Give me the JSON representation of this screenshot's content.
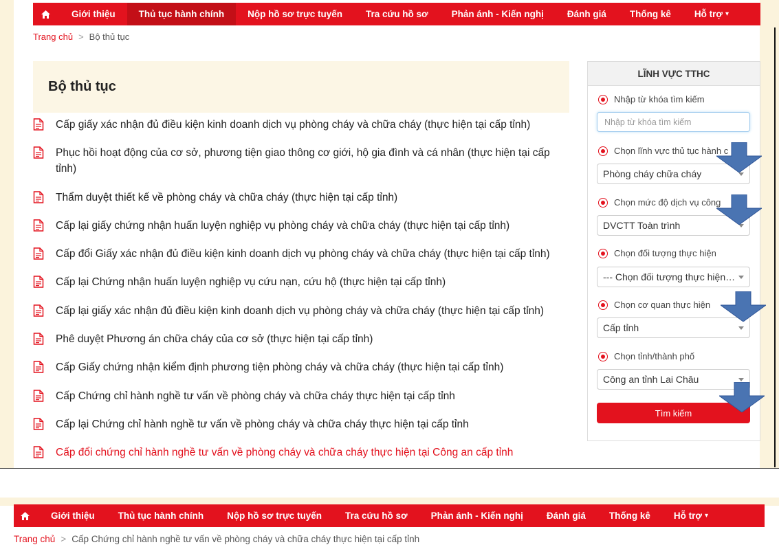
{
  "colors": {
    "brand_red": "#e3121e",
    "active_red": "#c30f17",
    "header_bg": "#fcf6e5"
  },
  "nav_top": {
    "home_icon": "home-icon",
    "items": [
      "Giới thiệu",
      "Thủ tục hành chính",
      "Nộp hồ sơ trực tuyến",
      "Tra cứu hồ sơ",
      "Phản ánh - Kiến nghị",
      "Đánh giá",
      "Thống kê",
      "Hỗ trợ"
    ],
    "active_index": 1,
    "dropdown_caret": "▾"
  },
  "breadcrumb_top": {
    "home": "Trang chủ",
    "sep": ">",
    "current": "Bộ thủ tục"
  },
  "main": {
    "title": "Bộ thủ tục",
    "procedures": [
      "Cấp giấy xác nhận đủ điều kiện kinh doanh dịch vụ phòng cháy và chữa cháy (thực hiện tại cấp tỉnh)",
      "Phục hồi hoạt động của cơ sở, phương tiện giao thông cơ giới, hộ gia đình và cá nhân (thực hiện tại cấp tỉnh)",
      "Thẩm duyệt thiết kế về phòng cháy và chữa cháy (thực hiện tại cấp tỉnh)",
      "Cấp lại giấy chứng nhận huấn luyện nghiệp vụ phòng cháy và chữa cháy (thực hiện tại cấp tỉnh)",
      "Cấp đổi Giấy xác nhận đủ điều kiện kinh doanh dịch vụ phòng cháy và chữa cháy (thực hiện tại cấp tỉnh)",
      "Cấp lại Chứng nhận huấn luyện nghiệp vụ cứu nạn, cứu hộ (thực hiện tại cấp tỉnh)",
      "Cấp lại giấy xác nhận đủ điều kiện kinh doanh dịch vụ phòng cháy và chữa cháy (thực hiện tại cấp tỉnh)",
      "Phê duyệt Phương án chữa cháy của cơ sở (thực hiện tại cấp tỉnh)",
      "Cấp Giấy chứng nhận kiểm định phương tiện phòng cháy và chữa cháy (thực hiện tại cấp tỉnh)",
      "Cấp Chứng chỉ hành nghề tư vấn về phòng cháy và chữa cháy thực hiện tại cấp tỉnh",
      "Cấp lại Chứng chỉ hành nghề tư vấn về phòng cháy và chữa cháy thực hiện tại cấp tỉnh",
      "Cấp đổi chứng chỉ hành nghề tư vấn về phòng cháy và chữa cháy thực hiện tại Công an cấp tỉnh"
    ],
    "highlighted_index": 11,
    "doc_icon": "document-icon"
  },
  "panel": {
    "title": "LĨNH VỰC TTHC",
    "keyword_label": "Nhập từ khóa tìm kiếm",
    "keyword_placeholder": "Nhập từ khóa tìm kiếm",
    "field_label": "Chọn lĩnh vực thủ tục hành c",
    "field_value": "Phòng cháy chữa cháy",
    "level_label": "Chọn mức độ dịch vụ công",
    "level_value": "DVCTT Toàn trình",
    "subject_label": "Chọn đối tượng thực hiện",
    "subject_value": "--- Chọn đối tượng thực hiện ---",
    "agency_label": "Chọn cơ quan thực hiện",
    "agency_value": "Cấp tỉnh",
    "province_label": "Chọn tỉnh/thành phố",
    "province_value": "Công an tỉnh Lai Châu",
    "search_button": "Tìm kiếm",
    "arrow_icon": "pointer-arrow-icon"
  },
  "nav_bottom": {
    "items": [
      "Giới thiệu",
      "Thủ tục hành chính",
      "Nộp hồ sơ trực tuyến",
      "Tra cứu hồ sơ",
      "Phản ánh - Kiến nghị",
      "Đánh giá",
      "Thống kê",
      "Hỗ trợ"
    ]
  },
  "breadcrumb_bottom": {
    "home": "Trang chủ",
    "sep": ">",
    "current": "Cấp Chứng chỉ hành nghề tư vấn về phòng cháy và chữa cháy thực hiện tại cấp tỉnh"
  }
}
